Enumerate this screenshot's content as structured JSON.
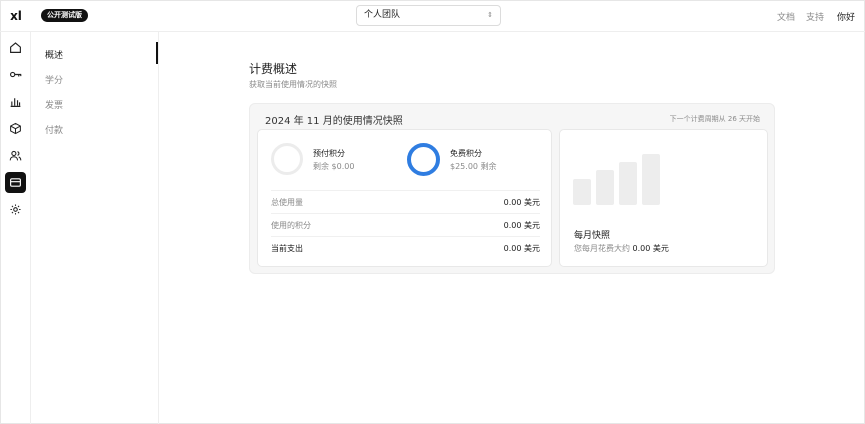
{
  "app": {
    "logo_text": "xl",
    "beta_badge": "公开测试版"
  },
  "header": {
    "team_selector": "个人团队",
    "links": {
      "docs": "文档",
      "support": "支持",
      "greeting": "你好"
    }
  },
  "rail": {
    "icons": [
      "home-icon",
      "key-icon",
      "bar-chart-icon",
      "cube-icon",
      "users-icon",
      "billing-card-icon",
      "settings-gear-icon"
    ],
    "active": "billing-card-icon",
    "active_color": "#111111"
  },
  "subnav": {
    "items": [
      {
        "label": "概述",
        "active": true
      },
      {
        "label": "学分",
        "active": false
      },
      {
        "label": "发票",
        "active": false
      },
      {
        "label": "付款",
        "active": false
      }
    ]
  },
  "main": {
    "title": "计费概述",
    "subtitle": "获取当前使用情况的快照",
    "panel": {
      "title": "2024 年 11 月的使用情况快照",
      "note": "下一个计费周期从 26 天开始",
      "credits": [
        {
          "name": "预付积分",
          "detail": "剩余 $0.00",
          "ring_color": "#ececec"
        },
        {
          "name": "免费积分",
          "detail": "$25.00 剩余",
          "ring_color": "#2f7de1"
        }
      ],
      "rows": [
        {
          "label": "总使用量",
          "value": "0.00 美元"
        },
        {
          "label": "使用的积分",
          "value": "0.00 美元"
        },
        {
          "label": "当前支出",
          "value": "0.00 美元"
        }
      ],
      "monthly": {
        "title": "每月快照",
        "subtitle_prefix": "您每月花费大约",
        "subtitle_value": "0.00 美元"
      }
    }
  }
}
